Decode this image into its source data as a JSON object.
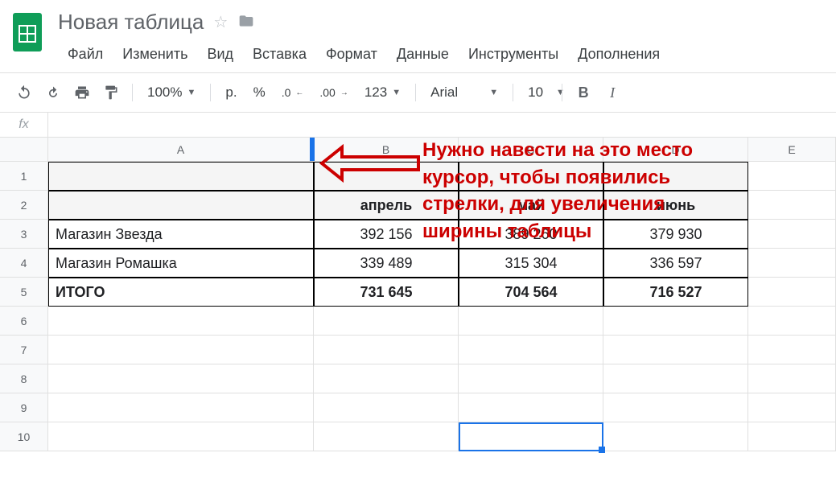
{
  "document": {
    "title": "Новая таблица"
  },
  "menu": {
    "file": "Файл",
    "edit": "Изменить",
    "view": "Вид",
    "insert": "Вставка",
    "format": "Формат",
    "data": "Данные",
    "tools": "Инструменты",
    "addons": "Дополнения"
  },
  "toolbar": {
    "zoom": "100%",
    "currency": "р.",
    "percent": "%",
    "dec_dec": ".0",
    "dec_inc": ".00",
    "format_123": "123",
    "font_name": "Arial",
    "font_size": "10",
    "bold": "B",
    "italic": "I"
  },
  "fx_label": "fx",
  "columns": {
    "A": "A",
    "B": "B",
    "C": "C",
    "D": "D",
    "E": "E"
  },
  "rows": [
    "1",
    "2",
    "3",
    "4",
    "5",
    "6",
    "7",
    "8",
    "9",
    "10"
  ],
  "data": {
    "headers": {
      "b2": "апрель",
      "c2": "май",
      "d2": "июнь"
    },
    "r3": {
      "a": "Магазин Звезда",
      "b": "392 156",
      "c": "389 260",
      "d": "379 930"
    },
    "r4": {
      "a": "Магазин Ромашка",
      "b": "339 489",
      "c": "315 304",
      "d": "336 597"
    },
    "r5": {
      "a": "ИТОГО",
      "b": "731 645",
      "c": "704 564",
      "d": "716 527"
    }
  },
  "annotation": {
    "text1": "Нужно навести на это место",
    "text2": "курсор, чтобы появились",
    "text3": "стрелки, для увеличения",
    "text4": "ширины таблицы"
  }
}
